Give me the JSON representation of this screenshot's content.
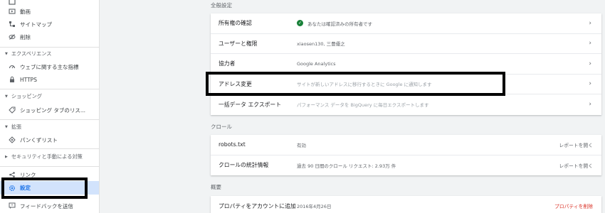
{
  "sidebar": {
    "items_top": [
      {
        "label": "動画",
        "icon": "video-icon"
      },
      {
        "label": "サイトマップ",
        "icon": "sitemap-icon"
      },
      {
        "label": "削除",
        "icon": "removal-icon"
      }
    ],
    "experience": {
      "header": "エクスペリエンス",
      "items": [
        {
          "label": "ウェブに関する主な指標",
          "icon": "web-vitals-icon"
        },
        {
          "label": "HTTPS",
          "icon": "lock-icon"
        }
      ]
    },
    "shopping": {
      "header": "ショッピング",
      "items": [
        {
          "label": "ショッピング タブのリス...",
          "icon": "tag-icon"
        }
      ]
    },
    "enhancements": {
      "header": "拡張",
      "items": [
        {
          "label": "パンくずリスト",
          "icon": "breadcrumb-icon"
        }
      ]
    },
    "security": {
      "header": "セキュリティと手動による対策"
    },
    "bottom": [
      {
        "label": "リンク",
        "icon": "link-icon"
      },
      {
        "label": "設定",
        "icon": "gear-icon"
      },
      {
        "label": "フィードバックを送信",
        "icon": "feedback-icon"
      }
    ]
  },
  "general": {
    "title": "全般設定",
    "rows": [
      {
        "label": "所有権の確認",
        "value": "あなたは確認済みの所有者です"
      },
      {
        "label": "ユーザーと権限",
        "value": "xiaosen130, 三豊優之"
      },
      {
        "label": "協力者",
        "value": "Google Analytics"
      },
      {
        "label": "アドレス変更",
        "value": "サイトが新しいアドレスに移行するときに Google に通知します"
      },
      {
        "label": "一括データ エクスポート",
        "value": "パフォーマンス データを BigQuery に毎日エクスポートします"
      }
    ]
  },
  "crawl": {
    "title": "クロール",
    "rows": [
      {
        "label": "robots.txt",
        "value": "有効",
        "action": "レポートを開く"
      },
      {
        "label": "クロールの統計情報",
        "value": "過去 90 日間のクロール リクエスト: 2.93万 件",
        "action": "レポートを開く"
      }
    ]
  },
  "overview": {
    "title": "概要",
    "rows": [
      {
        "label": "プロパティをアカウントに追加",
        "value": "2016年4月26日",
        "action": "プロパティを削除"
      }
    ]
  },
  "colors": {
    "accent": "#1a73e8",
    "selected_bg": "#d2e3fc",
    "danger": "#d93025",
    "success": "#188038",
    "highlight_border": "#000000"
  }
}
